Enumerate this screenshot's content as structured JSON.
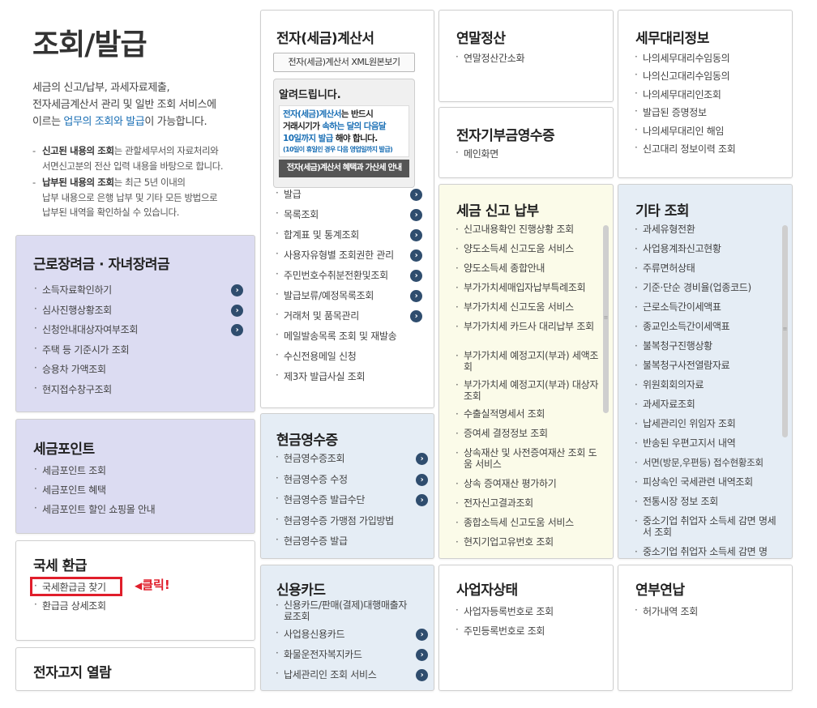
{
  "intro": {
    "title": "조회/발급",
    "desc_line1": "세금의 신고/납부, 과세자료제출,",
    "desc_line2": "전자세금계산서 관리 및 일반 조회 서비스에",
    "desc_line3a": "이르는 ",
    "desc_line3b": "업무의 조회와 발급",
    "desc_line3c": "이 가능합니다.",
    "note1_bold": "신고된 내용의 조회",
    "note1_rest": "는 관할세무서의 자료처리와",
    "note1_line2": "서면신고분의 전산 입력 내용을 바탕으로 합니다.",
    "note2_bold": "납부된 내용의 조회",
    "note2_rest": "는 최근 5년 이내의",
    "note2_line2": "납부 내용으로 은행 납부 및 기타 모든 방법으로",
    "note2_line3": "납부된 내역을 확인하실 수 있습니다."
  },
  "earned_income": {
    "title": "근로장려금 · 자녀장려금",
    "items": [
      "소득자료확인하기",
      "심사진행상황조회",
      "신청안내대상자여부조회",
      "주택 등 기준시가 조회",
      "승용차 가액조회",
      "현지접수창구조회"
    ]
  },
  "tax_point": {
    "title": "세금포인트",
    "items": [
      "세금포인트 조회",
      "세금포인트 혜택",
      "세금포인트 할인 쇼핑몰 안내"
    ]
  },
  "refund": {
    "title": "국세 환급",
    "items": [
      "국세환급금 찾기",
      "환급금 상세조회"
    ],
    "click_label": "클릭!"
  },
  "e_notice": {
    "title": "전자고지 열람"
  },
  "e_invoice": {
    "title": "전자(세금)계산서",
    "xml_button": "전자(세금)계산서 XML원본보기",
    "notice_title": "알려드립니다.",
    "notice_part1": "전자(세금)계산서",
    "notice_part2": "는 반드시",
    "notice_line2a": "거래시기가 ",
    "notice_line2b": "속하는 달의 다음달",
    "notice_line3a": "10일까지 발급",
    "notice_line3b": " 해야 합니다.",
    "notice_small": "(10일이 휴일인 경우 다음 영업일까지 발급)",
    "notice_button": "전자(세금)계산서 혜택과 가산세 안내",
    "items": [
      "발급",
      "목록조회",
      "합계표 및 통계조회",
      "사용자유형별 조회권한 관리",
      "주민번호수취분전환및조회",
      "발급보류/예정목록조회",
      "거래처 및 품목관리",
      "메일발송목록 조회 및 재발송",
      "수신전용메일 신청",
      "제3자 발급사실 조회"
    ]
  },
  "cash_receipt": {
    "title": "현금영수증",
    "items": [
      "현금영수증조회",
      "현금영수증 수정",
      "현금영수증 발급수단",
      "현금영수증 가맹점 가입방법",
      "현금영수증 발급"
    ]
  },
  "credit_card": {
    "title": "신용카드",
    "items": [
      "신용카드/판매(결제)대행매출자료조회",
      "사업용신용카드",
      "화물운전자복지카드",
      "납세관리인 조회 서비스"
    ]
  },
  "year_end": {
    "title": "연말정산",
    "items": [
      "연말정산간소화"
    ]
  },
  "donation": {
    "title": "전자기부금영수증",
    "items": [
      "메인화면"
    ]
  },
  "tax_filing": {
    "title": "세금 신고 납부",
    "items": [
      "신고내용확인 진행상황 조회",
      "양도소득세 신고도움 서비스",
      "양도소득세 종합안내",
      "부가가치세매입자납부특례조회",
      "부가가치세 신고도움 서비스",
      "부가가치세 카드사 대리납부 조회",
      "부가가치세 예정고지(부과) 세액조회",
      "부가가치세 예정고지(부과) 대상자 조회",
      "수출실적명세서 조회",
      "증여세 결정정보 조회",
      "상속재산 및 사전증여재산 조회 도움 서비스",
      "상속 증여재산 평가하기",
      "전자신고결과조회",
      "종합소득세 신고도움 서비스",
      "현지기업고유번호 조회"
    ]
  },
  "business_status": {
    "title": "사업자상태",
    "items": [
      "사업자등록번호로 조회",
      "주민등록번호로 조회"
    ]
  },
  "tax_agent": {
    "title": "세무대리정보",
    "items": [
      "나의세무대리수임동의",
      "나의신고대리수임동의",
      "나의세무대리인조회",
      "발급된 증명정보",
      "나의세무대리인 해임",
      "신고대리 정보이력 조회"
    ]
  },
  "other": {
    "title": "기타 조회",
    "items": [
      "과세유형전환",
      "사업용계좌신고현황",
      "주류면허상태",
      "기준·단순 경비율(업종코드)",
      "근로소득간이세액표",
      "종교인소득간이세액표",
      "불복청구진행상황",
      "불복청구사전열람자료",
      "위원회회의자료",
      "과세자료조회",
      "납세관리인 위임자 조회",
      "반송된 우편고지서 내역",
      "서면(방문,우편등) 접수현황조회",
      "피상속인 국세관련 내역조회",
      "전통시장 정보 조회",
      "중소기업 취업자 소득세 감면 명세서 조회",
      "중소기업 취업자 소득세 감면 명"
    ]
  },
  "installment": {
    "title": "연부연납",
    "items": [
      "허가내역 조회"
    ]
  },
  "colors": {
    "accent_blue": "#1a6fb5",
    "arrow_red": "#e01e2b",
    "highlight_box": "#e01e2b",
    "arrow_icon_bg": "#2f4d6e"
  }
}
